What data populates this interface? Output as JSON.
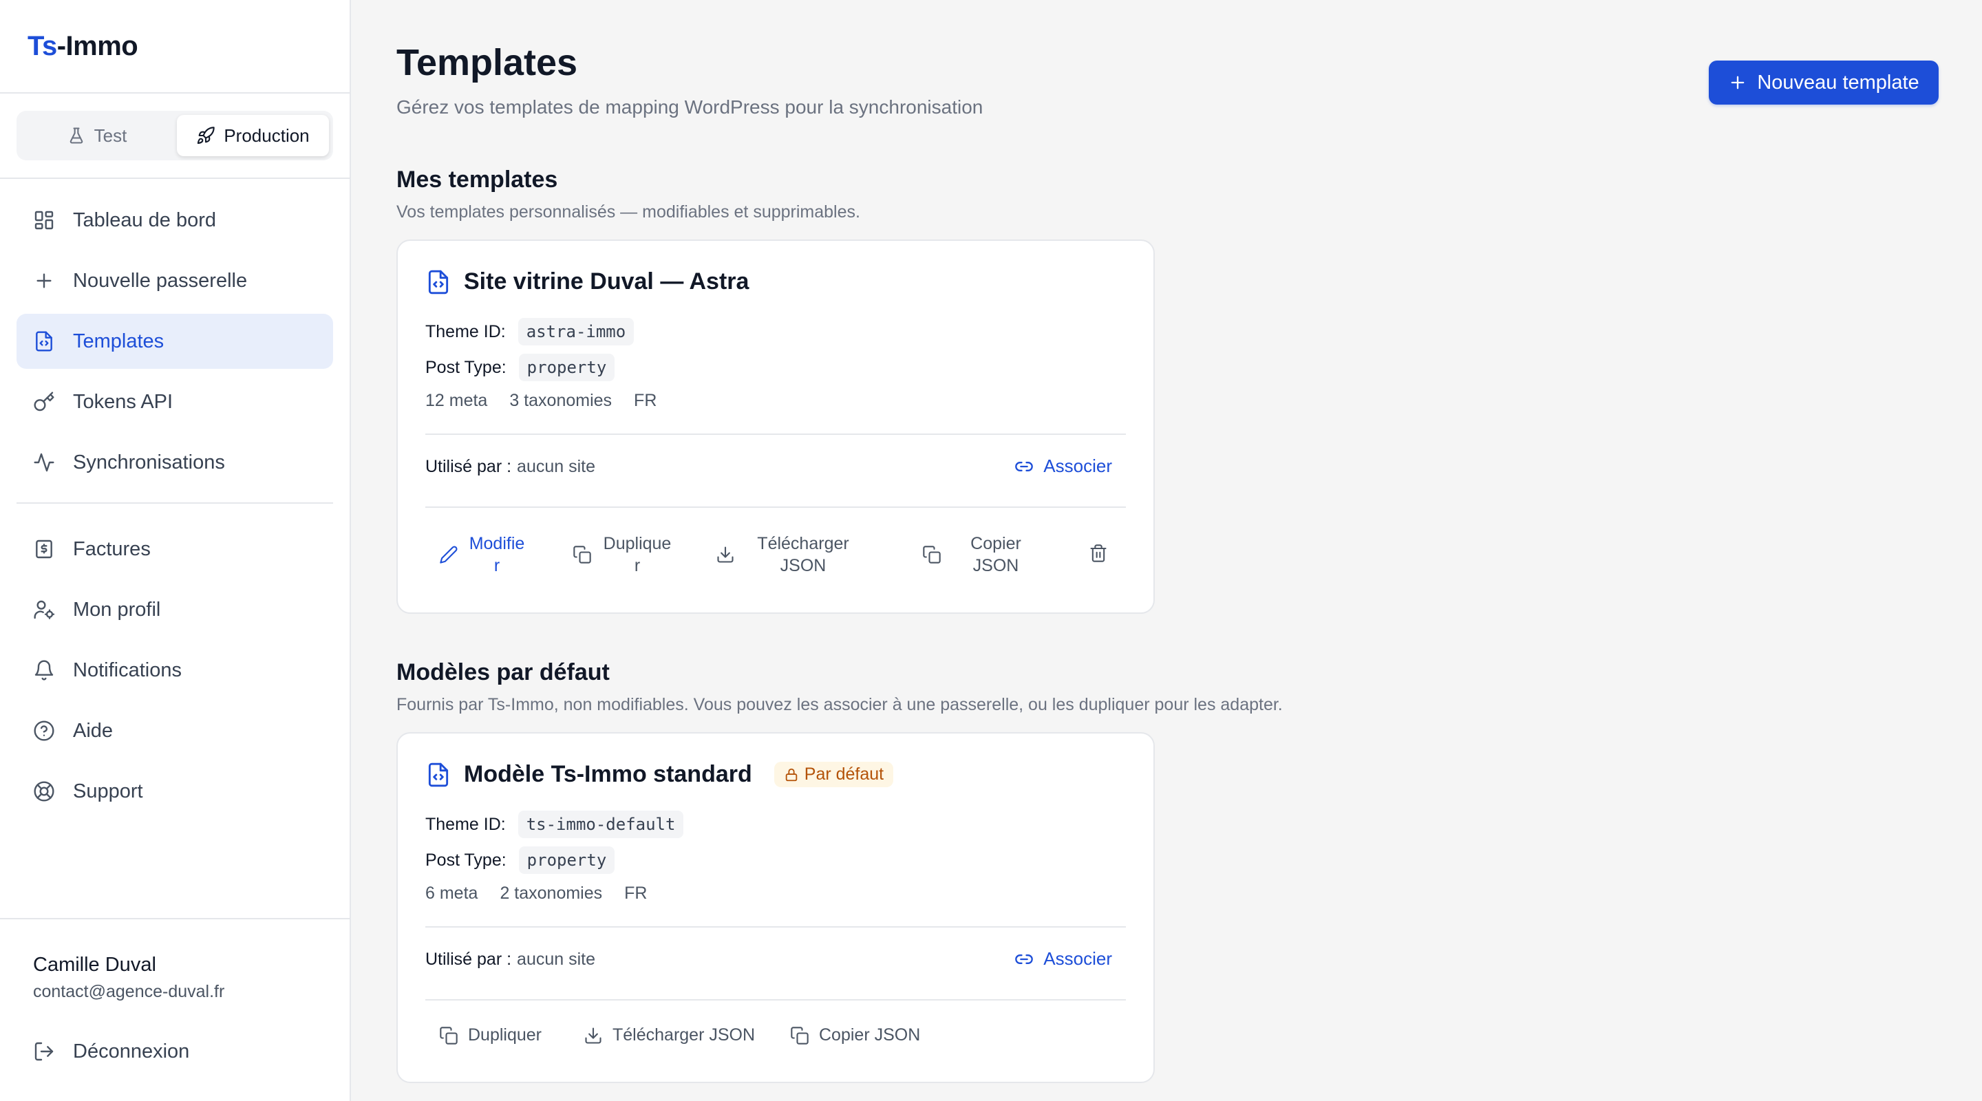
{
  "brand": {
    "part1": "Ts",
    "part2": "-Immo"
  },
  "env": {
    "test_label": "Test",
    "production_label": "Production",
    "active": "production"
  },
  "nav": {
    "items": [
      {
        "label": "Tableau de bord",
        "icon": "dashboard-icon"
      },
      {
        "label": "Nouvelle passerelle",
        "icon": "plus-icon"
      },
      {
        "label": "Templates",
        "icon": "file-code-icon",
        "active": true
      },
      {
        "label": "Tokens API",
        "icon": "key-icon"
      },
      {
        "label": "Synchronisations",
        "icon": "activity-icon"
      }
    ],
    "items2": [
      {
        "label": "Factures",
        "icon": "receipt-icon"
      },
      {
        "label": "Mon profil",
        "icon": "user-cog-icon"
      },
      {
        "label": "Notifications",
        "icon": "bell-icon"
      },
      {
        "label": "Aide",
        "icon": "help-circle-icon"
      },
      {
        "label": "Support",
        "icon": "life-buoy-icon"
      }
    ]
  },
  "user": {
    "name": "Camille Duval",
    "email": "contact@agence-duval.fr"
  },
  "logout_label": "Déconnexion",
  "header": {
    "title": "Templates",
    "subtitle": "Gérez vos templates de mapping WordPress pour la synchronisation",
    "new_button": "Nouveau template"
  },
  "my_templates": {
    "title": "Mes templates",
    "desc": "Vos templates personnalisés — modifiables et supprimables.",
    "card": {
      "title": "Site vitrine Duval — Astra",
      "theme_label": "Theme ID:",
      "theme_id": "astra-immo",
      "post_type_label": "Post Type:",
      "post_type": "property",
      "meta": "12 meta",
      "taxonomies": "3 taxonomies",
      "lang": "FR",
      "used_label": "Utilisé par :",
      "used_value": "aucun site",
      "associate": "Associer",
      "actions": {
        "edit": "Modifier",
        "duplicate": "Dupliquer",
        "download": "Télécharger JSON",
        "copy": "Copier JSON"
      }
    }
  },
  "defaults": {
    "title": "Modèles par défaut",
    "desc": "Fournis par Ts-Immo, non modifiables. Vous pouvez les associer à une passerelle, ou les dupliquer pour les adapter.",
    "card": {
      "title": "Modèle Ts-Immo standard",
      "badge": "Par défaut",
      "theme_label": "Theme ID:",
      "theme_id": "ts-immo-default",
      "post_type_label": "Post Type:",
      "post_type": "property",
      "meta": "6 meta",
      "taxonomies": "2 taxonomies",
      "lang": "FR",
      "used_label": "Utilisé par :",
      "used_value": "aucun site",
      "associate": "Associer",
      "actions": {
        "duplicate": "Dupliquer",
        "download": "Télécharger JSON",
        "copy": "Copier JSON"
      }
    }
  },
  "colors": {
    "accent": "#1d4ed8",
    "badge_bg": "#fef6e4",
    "badge_text": "#b45309"
  }
}
